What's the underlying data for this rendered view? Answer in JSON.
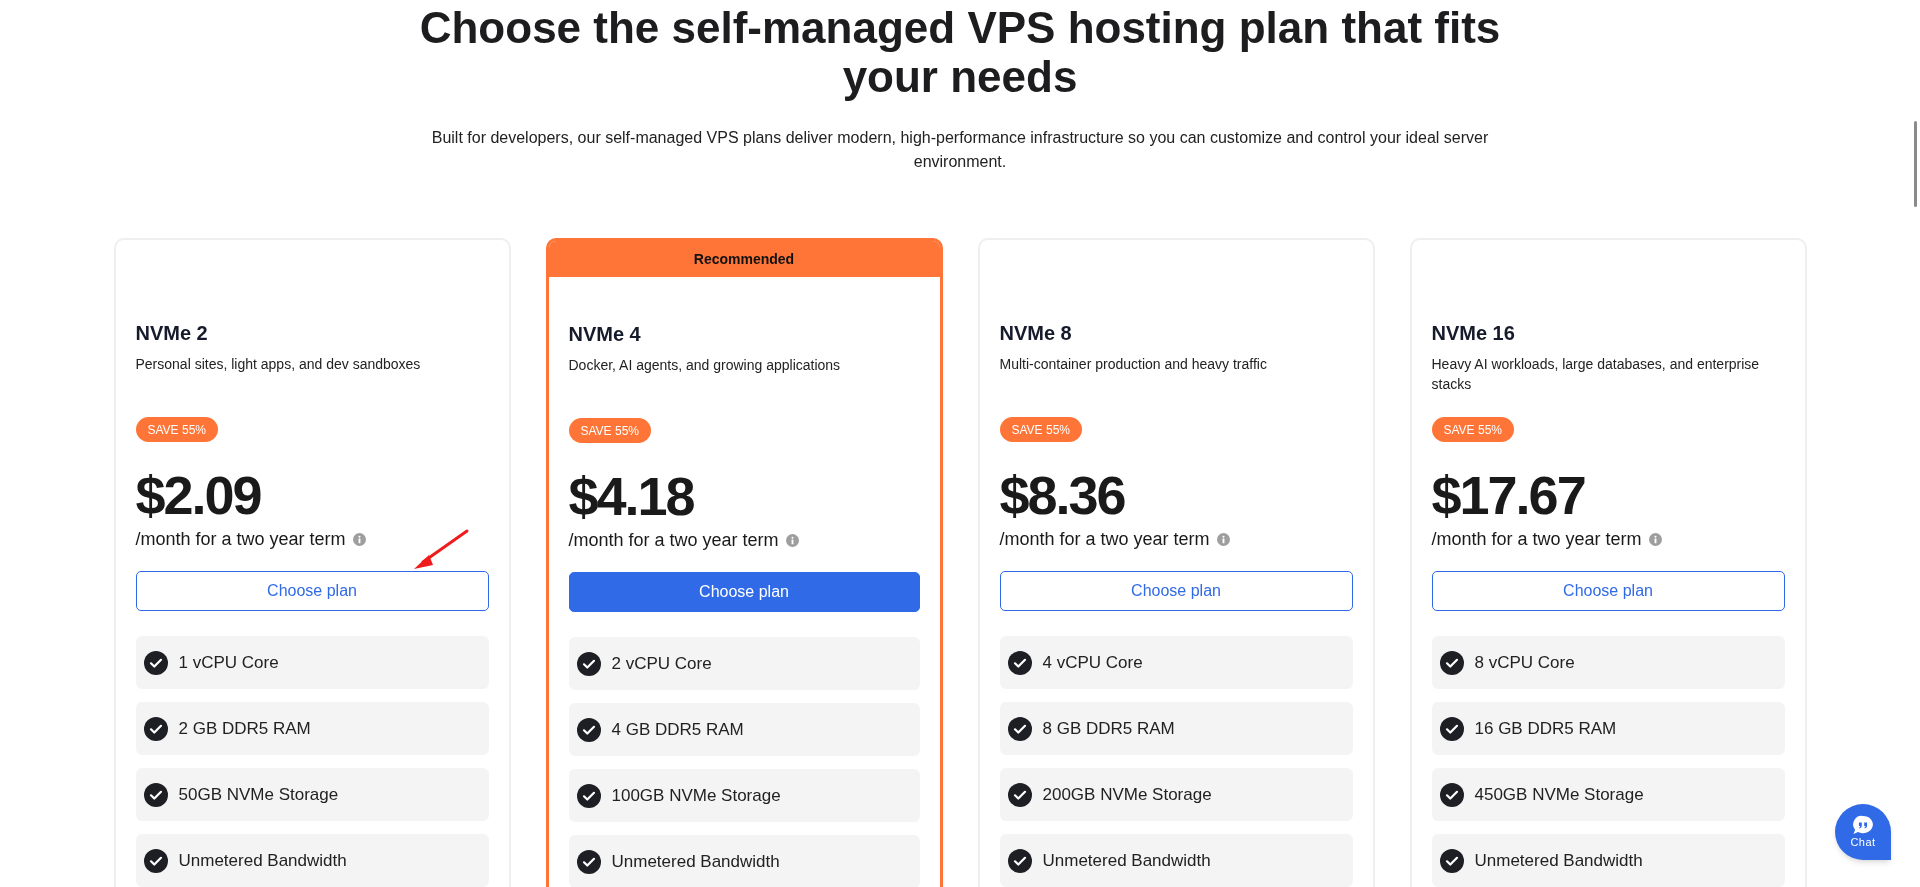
{
  "header": {
    "title": "Choose the self-managed VPS hosting plan that fits your needs",
    "subtitle": "Built for developers, our self-managed VPS plans deliver modern, high-performance infrastructure so you can customize and control your ideal server environment."
  },
  "plans": [
    {
      "recommended": false,
      "name": "NVMe 2",
      "description": "Personal sites, light apps, and dev sandboxes",
      "badge": "SAVE 55%",
      "price": "$2.09",
      "term": "/month for a two year term",
      "button": "Choose plan",
      "features": [
        "1 vCPU Core",
        "2 GB DDR5 RAM",
        "50GB NVMe Storage",
        "Unmetered Bandwidth"
      ]
    },
    {
      "recommended": true,
      "ribbon": "Recommended",
      "name": "NVMe 4",
      "description": "Docker, AI agents, and growing applications",
      "badge": "SAVE 55%",
      "price": "$4.18",
      "term": "/month for a two year term",
      "button": "Choose plan",
      "features": [
        "2 vCPU Core",
        "4 GB DDR5 RAM",
        "100GB NVMe Storage",
        "Unmetered Bandwidth"
      ]
    },
    {
      "recommended": false,
      "name": "NVMe 8",
      "description": "Multi-container production and heavy traffic",
      "badge": "SAVE 55%",
      "price": "$8.36",
      "term": "/month for a two year term",
      "button": "Choose plan",
      "features": [
        "4 vCPU Core",
        "8 GB DDR5 RAM",
        "200GB NVMe Storage",
        "Unmetered Bandwidth"
      ]
    },
    {
      "recommended": false,
      "name": "NVMe 16",
      "description": "Heavy AI workloads, large databases, and enterprise stacks",
      "badge": "SAVE 55%",
      "price": "$17.67",
      "term": "/month for a two year term",
      "button": "Choose plan",
      "features": [
        "8 vCPU Core",
        "16 GB DDR5 RAM",
        "450GB NVMe Storage",
        "Unmetered Bandwidth"
      ]
    }
  ],
  "chat_button": {
    "label": "Chat"
  }
}
